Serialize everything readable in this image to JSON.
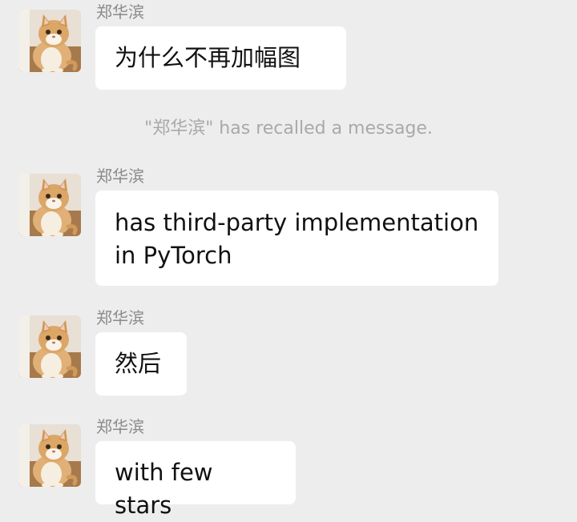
{
  "messages": [
    {
      "sender": "郑华滨",
      "text": "为什么不再加幅图"
    },
    {
      "sender": "郑华滨",
      "text": "has third-party implementation\nin PyTorch"
    },
    {
      "sender": "郑华滨",
      "text": "然后"
    },
    {
      "sender": "郑华滨",
      "text": "with few stars"
    }
  ],
  "system_notice": "\"郑华滨\" has recalled a message.",
  "avatar": {
    "icon": "cat-avatar-icon"
  },
  "colors": {
    "background": "#ededed",
    "bubble": "#ffffff",
    "sender_text": "#8a8a8a",
    "system_text": "#a9a9a9"
  }
}
